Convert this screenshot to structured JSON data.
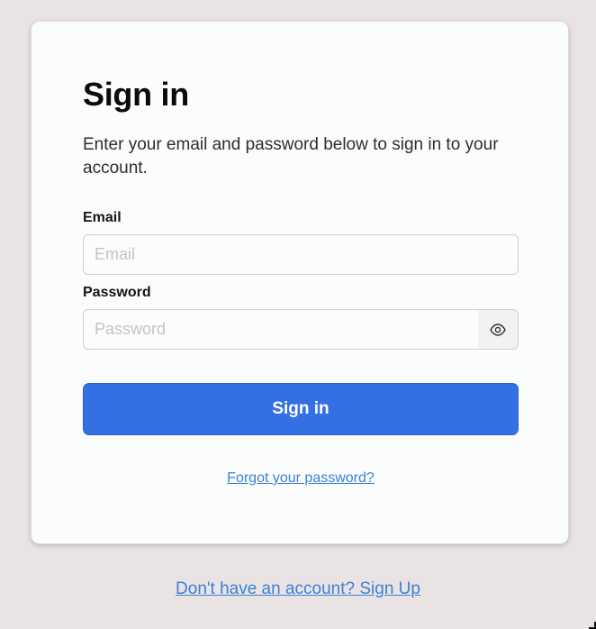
{
  "colors": {
    "page_background": "#e9e3e3",
    "card_background": "#fbfcfc",
    "primary": "#3370e3",
    "link": "#3b82d6"
  },
  "form": {
    "title": "Sign in",
    "subtitle": "Enter your email and password below to sign in to your account.",
    "email": {
      "label": "Email",
      "placeholder": "Email",
      "value": ""
    },
    "password": {
      "label": "Password",
      "placeholder": "Password",
      "value": "",
      "toggle_icon": "eye-icon"
    },
    "submit_label": "Sign in",
    "forgot_link": "Forgot your password?"
  },
  "footer": {
    "signup_link": "Don't have an account? Sign Up"
  }
}
